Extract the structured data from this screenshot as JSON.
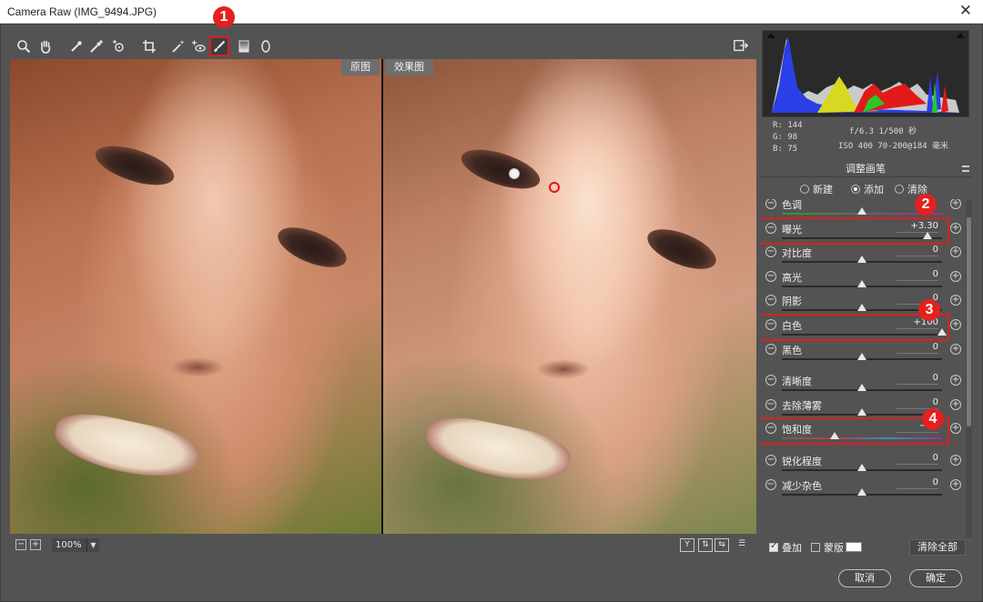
{
  "window": {
    "title": "Camera Raw (IMG_9494.JPG)"
  },
  "toolbar": {
    "tools": [
      "zoom-icon",
      "hand-icon",
      "white-balance-icon",
      "color-sampler-icon",
      "targeted-adjustment-icon",
      "crop-icon",
      "spot-removal-icon",
      "red-eye-icon",
      "adjustment-brush-icon",
      "graduated-filter-icon",
      "radial-filter-icon"
    ],
    "active_tool": "adjustment-brush-icon"
  },
  "preview": {
    "before_label": "原图",
    "after_label": "效果图",
    "zoom_value": "100%"
  },
  "readout": {
    "r": "R:  144",
    "g": "G:   98",
    "b": "B:   75",
    "exposure_info": "f/6.3   1/500 秒",
    "lens_info": "ISO 400   70-200@184 毫米"
  },
  "panel": {
    "title": "调整画笔",
    "modes": [
      "新建",
      "添加",
      "清除"
    ],
    "selected_mode": "添加",
    "sliders": [
      {
        "label": "色调",
        "value": "",
        "pos": 0.5,
        "track": "tint"
      },
      {
        "label": "曝光",
        "value": "+3.30",
        "pos": 0.91,
        "track": "plain",
        "highlight": true
      },
      {
        "label": "对比度",
        "value": "0",
        "pos": 0.5,
        "track": "plain"
      },
      {
        "label": "高光",
        "value": "0",
        "pos": 0.5,
        "track": "plain"
      },
      {
        "label": "阴影",
        "value": "0",
        "pos": 0.5,
        "track": "plain"
      },
      {
        "label": "白色",
        "value": "+100",
        "pos": 1.0,
        "track": "plain",
        "highlight": true
      },
      {
        "label": "黑色",
        "value": "0",
        "pos": 0.5,
        "track": "plain"
      },
      {
        "label": "清晰度",
        "value": "0",
        "pos": 0.5,
        "track": "plain"
      },
      {
        "label": "去除薄雾",
        "value": "0",
        "pos": 0.5,
        "track": "plain"
      },
      {
        "label": "饱和度",
        "value": "−35",
        "pos": 0.33,
        "track": "sat",
        "highlight": true
      },
      {
        "label": "锐化程度",
        "value": "0",
        "pos": 0.5,
        "track": "plain"
      },
      {
        "label": "减少杂色",
        "value": "0",
        "pos": 0.5,
        "track": "plain"
      }
    ],
    "overlay_label": "叠加",
    "mask_label": "蒙版",
    "clear_all_label": "清除全部"
  },
  "buttons": {
    "cancel": "取消",
    "ok": "确定"
  },
  "callouts": [
    "1",
    "2",
    "3",
    "4"
  ],
  "colors": {
    "panel_bg": "#535353",
    "callout_red": "#e3211f"
  }
}
